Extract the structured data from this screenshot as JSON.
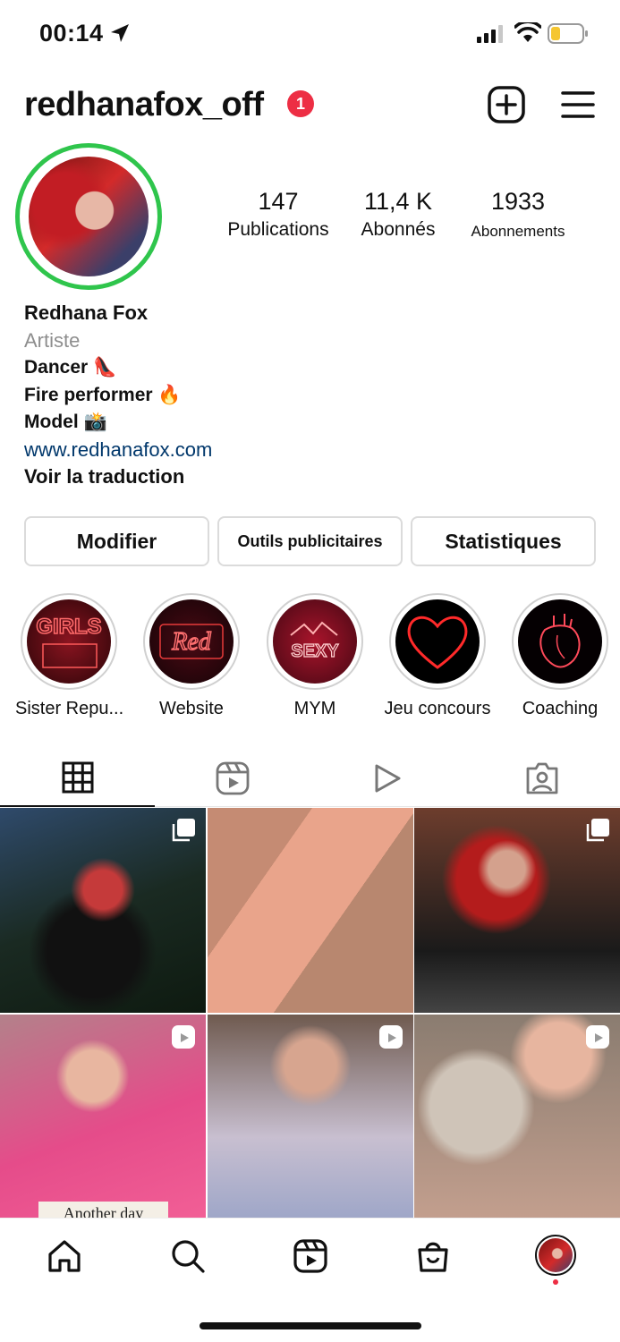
{
  "status_bar": {
    "time": "00:14",
    "icons": [
      "location-arrow-icon",
      "cellular-signal-icon",
      "wifi-icon",
      "battery-low-icon"
    ],
    "battery_color": "#f5c631"
  },
  "header": {
    "username": "redhanafox_off",
    "notification_count": "1",
    "badge_color": "#ed2e44",
    "icons": [
      "add-post-icon",
      "hamburger-menu-icon"
    ]
  },
  "profile": {
    "story_ring_color": "#2fc54c",
    "stats": {
      "posts": {
        "value": "147",
        "label": "Publications"
      },
      "followers": {
        "value": "11,4 K",
        "label": "Abonnés"
      },
      "following": {
        "value": "1933",
        "label": "Abonnements"
      }
    },
    "bio": {
      "name": "Redhana Fox",
      "category": "Artiste",
      "lines": [
        "Dancer 👠",
        "Fire performer 🔥",
        "Model 📸"
      ],
      "link": "www.redhanafox.com",
      "translate": "Voir la traduction"
    }
  },
  "actions": {
    "edit": "Modifier",
    "ad_tools": "Outils publicitaires",
    "insights": "Statistiques"
  },
  "highlights": [
    {
      "label": "Sister Repu...",
      "cover_text": "GIRLS"
    },
    {
      "label": "Website",
      "cover_text": "Red"
    },
    {
      "label": "MYM",
      "cover_text": "SEXY"
    },
    {
      "label": "Jeu concours",
      "cover_icon": "neon-heart-icon"
    },
    {
      "label": "Coaching",
      "cover_icon": "neon-anatomical-heart-icon"
    }
  ],
  "tabs": [
    "grid-icon",
    "reels-icon",
    "video-play-icon",
    "tagged-person-icon"
  ],
  "grid": {
    "posts": [
      {
        "badge": "carousel-icon"
      },
      {
        "badge": ""
      },
      {
        "badge": "carousel-icon"
      },
      {
        "badge": "reel-icon",
        "caption": "Another day"
      },
      {
        "badge": "reel-icon"
      },
      {
        "badge": "reel-icon"
      }
    ]
  },
  "bottom_nav": [
    "home-icon",
    "search-icon",
    "reels-icon",
    "shop-icon",
    "profile-avatar"
  ],
  "accent_color": "#00376b"
}
